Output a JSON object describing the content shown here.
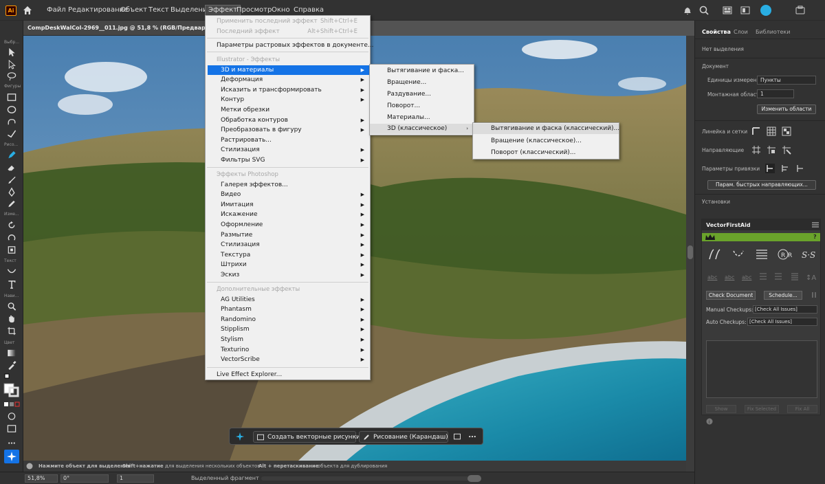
{
  "app": {
    "logo": "Ai"
  },
  "menubar": {
    "items": [
      "Файл",
      "Редактирование",
      "Объект",
      "Текст",
      "Выделение",
      "Эффект",
      "Просмотр",
      "Окно",
      "Справка"
    ],
    "active": "Эффект"
  },
  "doc_tab": {
    "title": "CompDeskWalCol-2969__011.jpg @ 51,8 % (RGB/Предварительный"
  },
  "toolbar_labels": [
    "Выбр...",
    "Фигуры",
    "Рисо...",
    "Изме...",
    "Текст",
    "Нави...",
    "Цвет"
  ],
  "effect_menu": {
    "apply_last": "Применить последний эффект",
    "apply_last_sc": "Shift+Ctrl+E",
    "last_effect": "Последний эффект",
    "last_effect_sc": "Alt+Shift+Ctrl+E",
    "raster_settings": "Параметры растровых эффектов в документе...",
    "illustrator_header": "Illustrator - Эффекты",
    "illustrator_items": [
      "3D и материалы",
      "Деформация",
      "Исказить и трансформировать",
      "Контур",
      "Метки обрезки",
      "Обработка контуров",
      "Преобразовать в фигуру",
      "Растрировать...",
      "Стилизация",
      "Фильтры SVG"
    ],
    "photoshop_header": "Эффекты Photoshop",
    "photoshop_items": [
      "Галерея эффектов...",
      "Видео",
      "Имитация",
      "Искажение",
      "Оформление",
      "Размытие",
      "Стилизация",
      "Текстура",
      "Штрихи",
      "Эскиз"
    ],
    "additional_header": "Дополнительные эффекты",
    "additional_items": [
      "AG Utilities",
      "Phantasm",
      "Randomino",
      "Stipplism",
      "Stylism",
      "Texturino",
      "VectorScribe"
    ],
    "live_explorer": "Live Effect Explorer..."
  },
  "submenu_3d": {
    "items": [
      "Вытягивание и фаска...",
      "Вращение...",
      "Раздувание...",
      "Поворот...",
      "Материалы...",
      "3D (классическое)"
    ]
  },
  "submenu_classic": {
    "items": [
      "Вытягивание и фаска (классический)...",
      "Вращение (классическое)...",
      "Поворот (классический)..."
    ]
  },
  "context_bar": {
    "vectorize": "Создать векторные рисунки",
    "draw": "Рисование (Карандаш)"
  },
  "status": {
    "hint1": "Нажмите объект для выделения",
    "shift": "Shift+нажатие",
    "hint2": "для выделения нескольких объектов",
    "alt": "Alt + перетаскивание",
    "hint3": "объекта для дублирования"
  },
  "bottom": {
    "zoom": "51,8%",
    "rotation": "0°",
    "artboard": "1",
    "mode": "Выделенный фрагмент"
  },
  "right_panel": {
    "tabs": [
      "Свойства",
      "Слои",
      "Библиотеки"
    ],
    "no_selection": "Нет выделения",
    "document": "Документ",
    "units_label": "Единицы измерения:",
    "units_value": "Пункты",
    "artboard_label": "Монтажная область:",
    "artboard_value": "1",
    "change_areas": "Изменить области",
    "rulers_grids": "Линейка и сетки",
    "guides": "Направляющие",
    "snap": "Параметры привязки",
    "smart_guides_btn": "Парам. быстрых направляющих...",
    "settings": "Установки"
  },
  "vfa": {
    "title": "VectorFirstAid",
    "help": "?",
    "check_document": "Check Document",
    "schedule": "Schedule...",
    "manual_label": "Manual Checkups:",
    "manual_value": "[Check All Issues]",
    "auto_label": "Auto Checkups:",
    "auto_value": "[Check All Issues]",
    "show": "Show",
    "fix_selected": "Fix Selected",
    "fix_all": "Fix All",
    "icon_text": [
      "abc",
      "abc",
      "abc"
    ]
  },
  "colors": {
    "accent": "#1473e6",
    "ui_dark": "#323232",
    "vfa_green": "#6aa32b",
    "logo_orange": "#ff9a00"
  }
}
